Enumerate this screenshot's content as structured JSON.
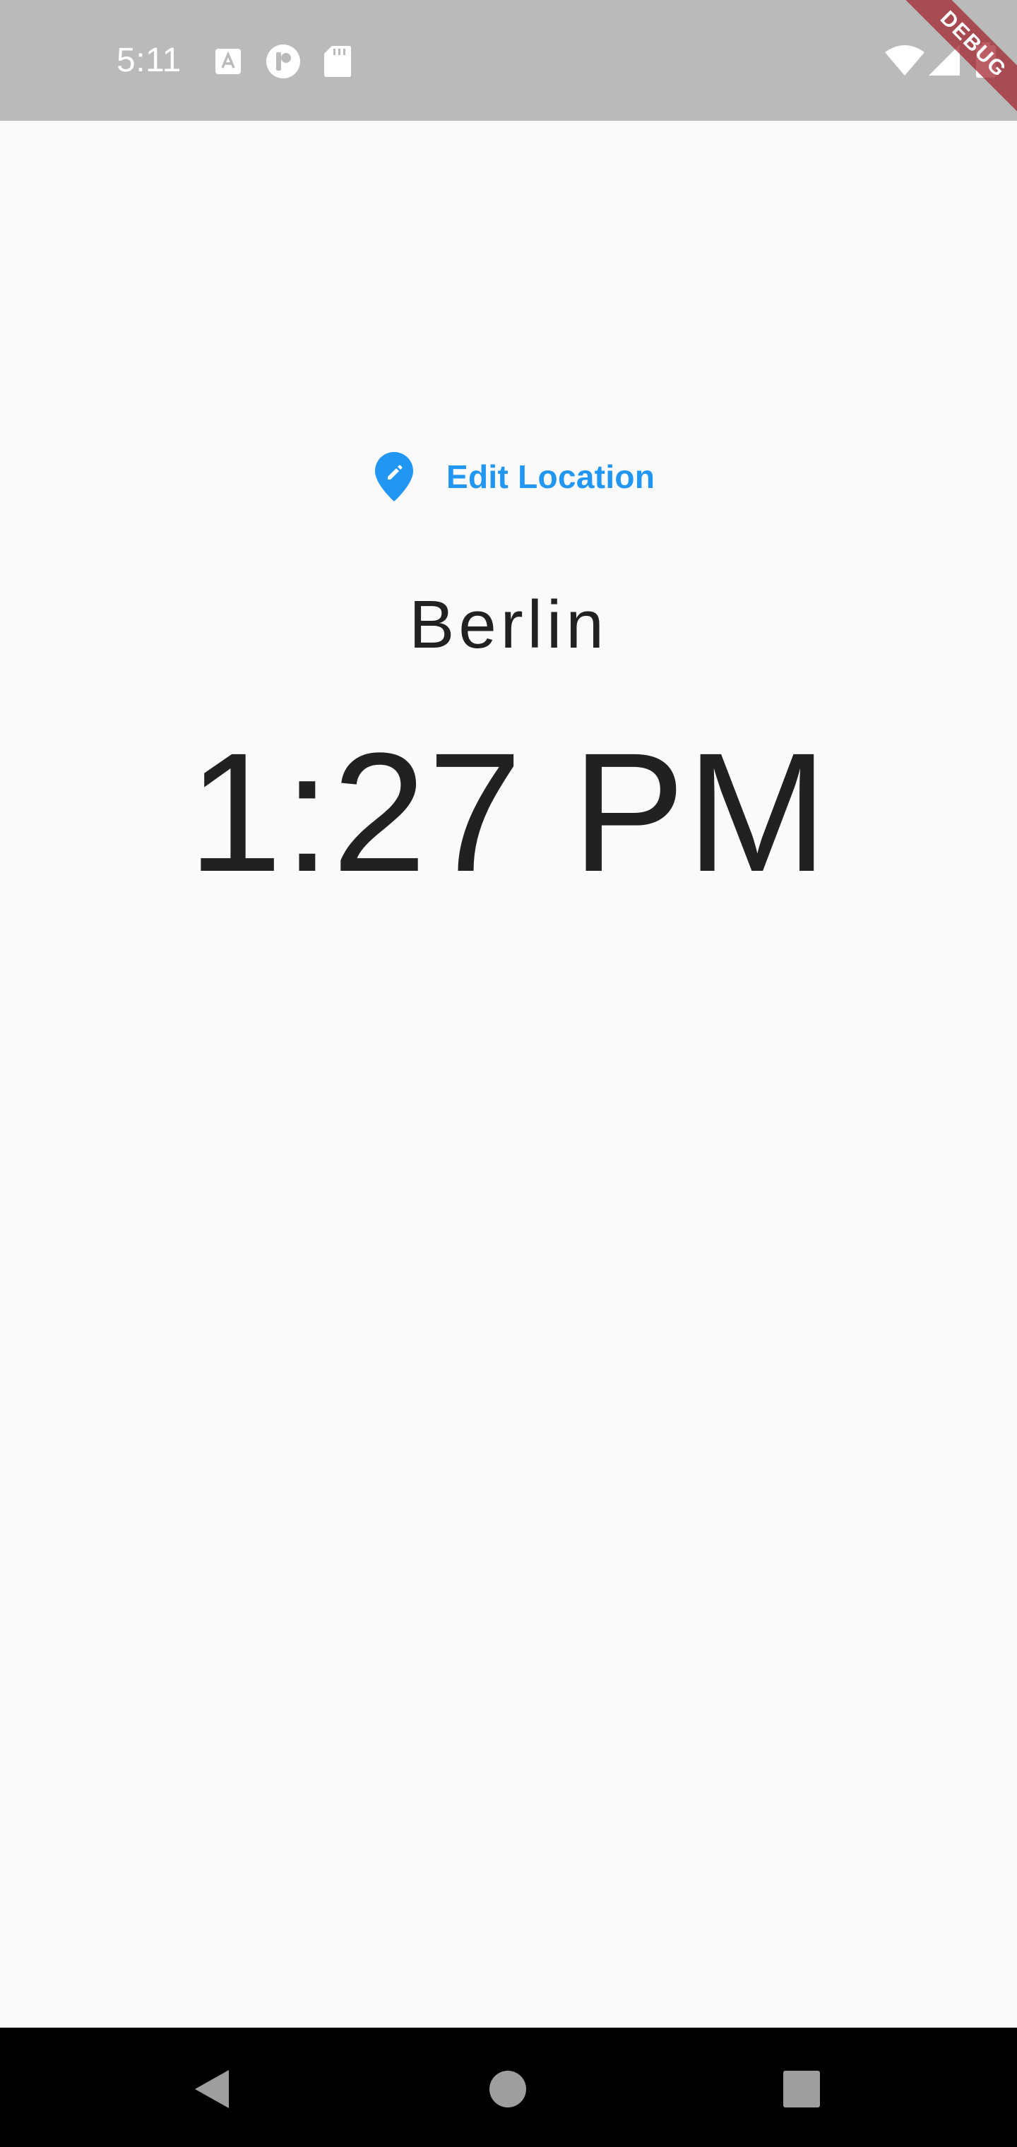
{
  "status_bar": {
    "time": "5:11",
    "icons": [
      "font-notification-icon",
      "circle-app-notification-icon",
      "sd-card-icon",
      "wifi-icon",
      "cell-signal-icon",
      "battery-icon"
    ]
  },
  "debug_banner": {
    "label": "DEBUG",
    "color": "#a01e28"
  },
  "main": {
    "edit_location_label": "Edit Location",
    "edit_location_icon": "edit-location-pin-icon",
    "city": "Berlin",
    "time": "1:27 PM"
  },
  "colors": {
    "accent": "#2196f3",
    "text": "#212121",
    "background": "#fafafa",
    "status_bar": "#bababa",
    "nav_bar": "#000000"
  },
  "nav_bar": {
    "buttons": [
      "back-icon",
      "home-icon",
      "recents-icon"
    ]
  }
}
